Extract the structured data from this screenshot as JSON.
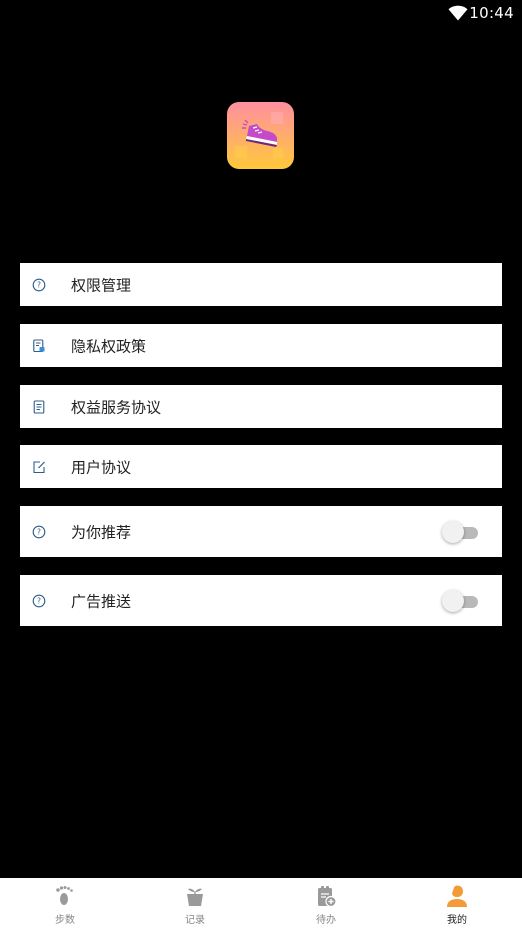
{
  "status_bar": {
    "time": "10:44",
    "wifi_icon": "wifi-icon"
  },
  "app": {
    "logo_icon": "sneaker-icon"
  },
  "menu": {
    "items": [
      {
        "label": "权限管理",
        "icon": "help-circle-icon"
      },
      {
        "label": "隐私权政策",
        "icon": "privacy-document-icon"
      },
      {
        "label": "权益服务协议",
        "icon": "document-icon"
      },
      {
        "label": "用户协议",
        "icon": "edit-icon"
      }
    ],
    "toggles": [
      {
        "label": "为你推荐",
        "icon": "help-circle-icon",
        "on": false
      },
      {
        "label": "广告推送",
        "icon": "help-circle-icon",
        "on": false
      }
    ]
  },
  "bottom_nav": {
    "items": [
      {
        "label": "步数",
        "icon": "footprint-icon",
        "active": false
      },
      {
        "label": "记录",
        "icon": "plant-pot-icon",
        "active": false
      },
      {
        "label": "待办",
        "icon": "clipboard-add-icon",
        "active": false
      },
      {
        "label": "我的",
        "icon": "user-icon",
        "active": true
      }
    ]
  },
  "colors": {
    "background": "#000000",
    "row_background": "#ffffff",
    "icon_blue": "#2f5d8a",
    "active_orange": "#f29b38",
    "inactive_gray": "#9a9a9a"
  }
}
